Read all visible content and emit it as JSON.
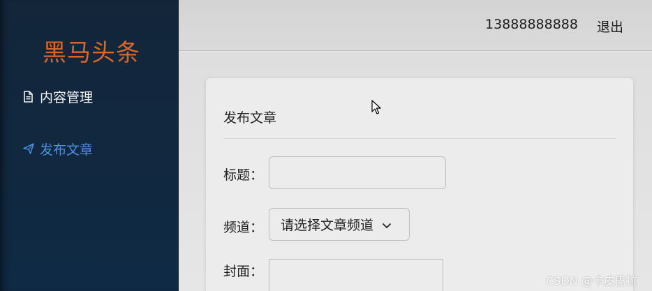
{
  "sidebar": {
    "brand": "黑马头条",
    "items": [
      {
        "label": "内容管理",
        "icon": "document-icon"
      },
      {
        "label": "发布文章",
        "icon": "send-icon",
        "active": true
      }
    ],
    "brand_color": "#d9662a",
    "active_color": "#4f8fe0"
  },
  "header": {
    "user_phone": "13888888888",
    "logout_label": "退出"
  },
  "form": {
    "card_title": "发布文章",
    "title_label": "标题：",
    "title_value": "",
    "channel_label": "频道：",
    "channel_placeholder": "请选择文章频道",
    "cover_label": "封面："
  },
  "watermark": "CSDN @卡皮巴拉"
}
